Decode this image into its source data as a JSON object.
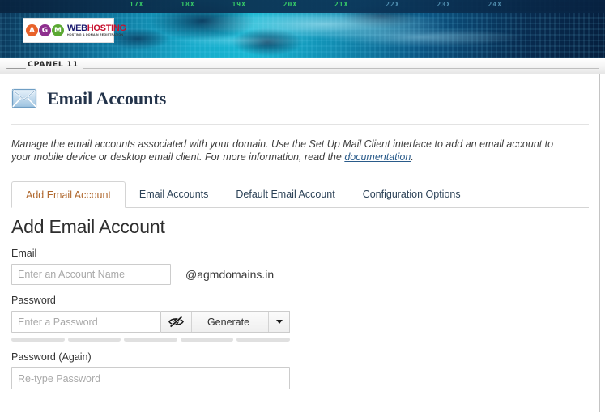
{
  "banner": {
    "logo": {
      "circles": [
        "A",
        "G",
        "M"
      ],
      "word_1": "WEB",
      "word_2": "HOSTING",
      "tagline": "HOSTING & DOMAIN REGISTRATION",
      "colors": {
        "a": "#e8622a",
        "g": "#8e2f8e",
        "m": "#5aa832",
        "web": "#1a1a6e",
        "hosting": "#c8102e"
      }
    },
    "ticker": [
      "17X",
      "18X",
      "19X",
      "20X",
      "21X",
      "22X",
      "23X",
      "24X"
    ]
  },
  "cpanel_bar": {
    "label": "CPANEL 11"
  },
  "page": {
    "title": "Email Accounts",
    "icon": "envelope-icon",
    "description_part_1": "Manage the email accounts associated with your domain. Use the Set Up Mail Client interface to add an email account to your mobile device or desktop email client. For more information, read the ",
    "description_link": "documentation",
    "description_part_2": "."
  },
  "tabs": [
    {
      "label": "Add Email Account",
      "active": true
    },
    {
      "label": "Email Accounts",
      "active": false
    },
    {
      "label": "Default Email Account",
      "active": false
    },
    {
      "label": "Configuration Options",
      "active": false
    }
  ],
  "form": {
    "section_title": "Add Email Account",
    "email": {
      "label": "Email",
      "placeholder": "Enter an Account Name",
      "value": "",
      "domain_suffix": "@agmdomains.in"
    },
    "password": {
      "label": "Password",
      "placeholder": "Enter a Password",
      "value": "",
      "toggle_icon": "eye-slash-icon",
      "generate_label": "Generate",
      "strength_segments": 5
    },
    "password_again": {
      "label": "Password (Again)",
      "placeholder": "Re-type Password",
      "value": ""
    }
  },
  "colors": {
    "active_tab_text": "#b0682e",
    "tab_text": "#2c4257",
    "link": "#2a5b8a",
    "title": "#23334a"
  }
}
